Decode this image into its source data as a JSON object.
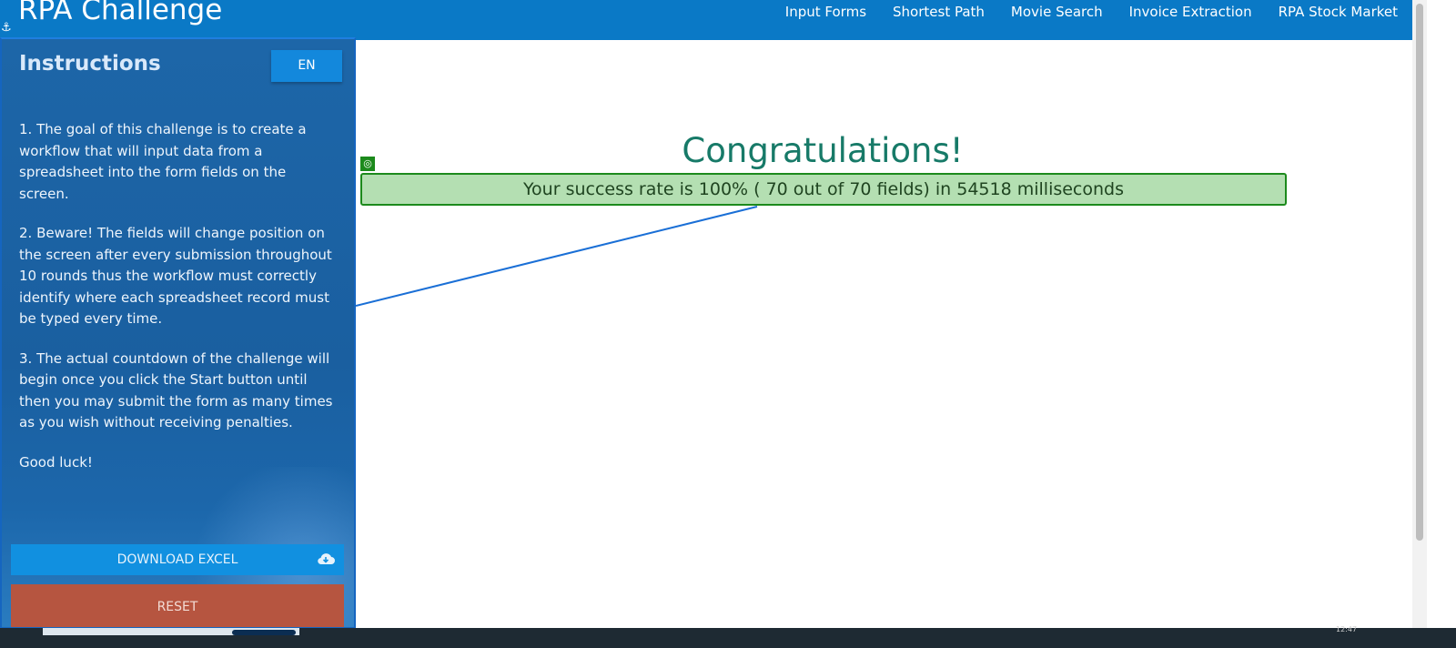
{
  "navbar": {
    "brand": "RPA Challenge",
    "links": [
      "Input Forms",
      "Shortest Path",
      "Movie Search",
      "Invoice Extraction",
      "RPA Stock Market"
    ]
  },
  "sidebar": {
    "title": "Instructions",
    "lang_button": "EN",
    "paragraphs": [
      "1. The goal of this challenge is to create a workflow that will input data from a spreadsheet into the form fields on the screen.",
      "2. Beware! The fields will change position on the screen after every submission throughout 10 rounds thus the workflow must correctly identify where each spreadsheet record must be typed every time.",
      "3. The actual countdown of the challenge will begin once you click the Start button until then you may submit the form as many times as you wish without receiving penalties.",
      "Good luck!"
    ],
    "download_label": "DOWNLOAD EXCEL",
    "reset_label": "RESET"
  },
  "main": {
    "heading": "Congratulations!",
    "result": "Your success rate is 100% ( 70 out of 70 fields) in 54518 milliseconds"
  },
  "taskbar": {
    "clock": "12:47"
  },
  "colors": {
    "navbar": "#0a79c6",
    "sidebar": "#1a5fa0",
    "download_button": "#1190e0",
    "reset_button": "#b65540",
    "heading": "#177a68",
    "success_bg": "#b4dfb2",
    "success_border": "#1c8a1c"
  }
}
